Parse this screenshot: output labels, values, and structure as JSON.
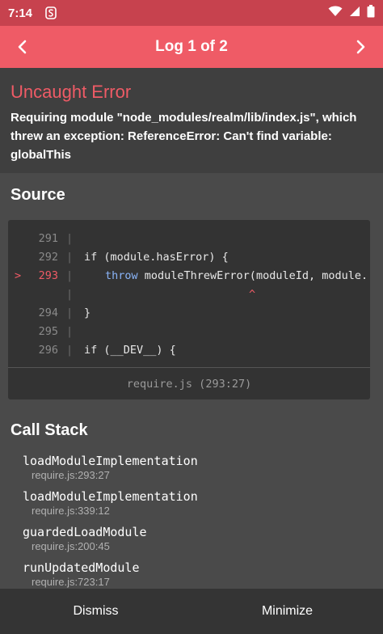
{
  "status_bar": {
    "time": "7:14"
  },
  "header": {
    "title": "Log 1 of 2"
  },
  "error": {
    "title": "Uncaught Error",
    "message": "Requiring module \"node_modules/realm/lib/index.js\", which threw an exception: ReferenceError: Can't find variable: globalThis"
  },
  "source": {
    "title": "Source",
    "lines": [
      {
        "num": "291",
        "marker": "",
        "code": ""
      },
      {
        "num": "292",
        "marker": "",
        "code": "if (module.hasError) {"
      },
      {
        "num": "293",
        "marker": ">",
        "keyword": "throw",
        "code": " moduleThrewError(moduleId, module."
      },
      {
        "num": "",
        "marker": "",
        "caret": "^"
      },
      {
        "num": "294",
        "marker": "",
        "code": "}"
      },
      {
        "num": "295",
        "marker": "",
        "code": ""
      },
      {
        "num": "296",
        "marker": "",
        "code": "if (__DEV__) {"
      }
    ],
    "footer": "require.js (293:27)"
  },
  "call_stack": {
    "title": "Call Stack",
    "frames": [
      {
        "fn": "loadModuleImplementation",
        "loc": "require.js:293:27"
      },
      {
        "fn": "loadModuleImplementation",
        "loc": "require.js:339:12"
      },
      {
        "fn": "guardedLoadModule",
        "loc": "require.js:200:45"
      },
      {
        "fn": "runUpdatedModule",
        "loc": "require.js:723:17"
      }
    ]
  },
  "bottom": {
    "dismiss": "Dismiss",
    "minimize": "Minimize"
  },
  "colors": {
    "accent": "#ef5b66",
    "status_bar": "#c7424e",
    "background": "#4a4a4a"
  },
  "icons": [
    "s-icon",
    "wifi-icon",
    "signal-icon",
    "battery-icon",
    "chevron-left-icon",
    "chevron-right-icon"
  ]
}
